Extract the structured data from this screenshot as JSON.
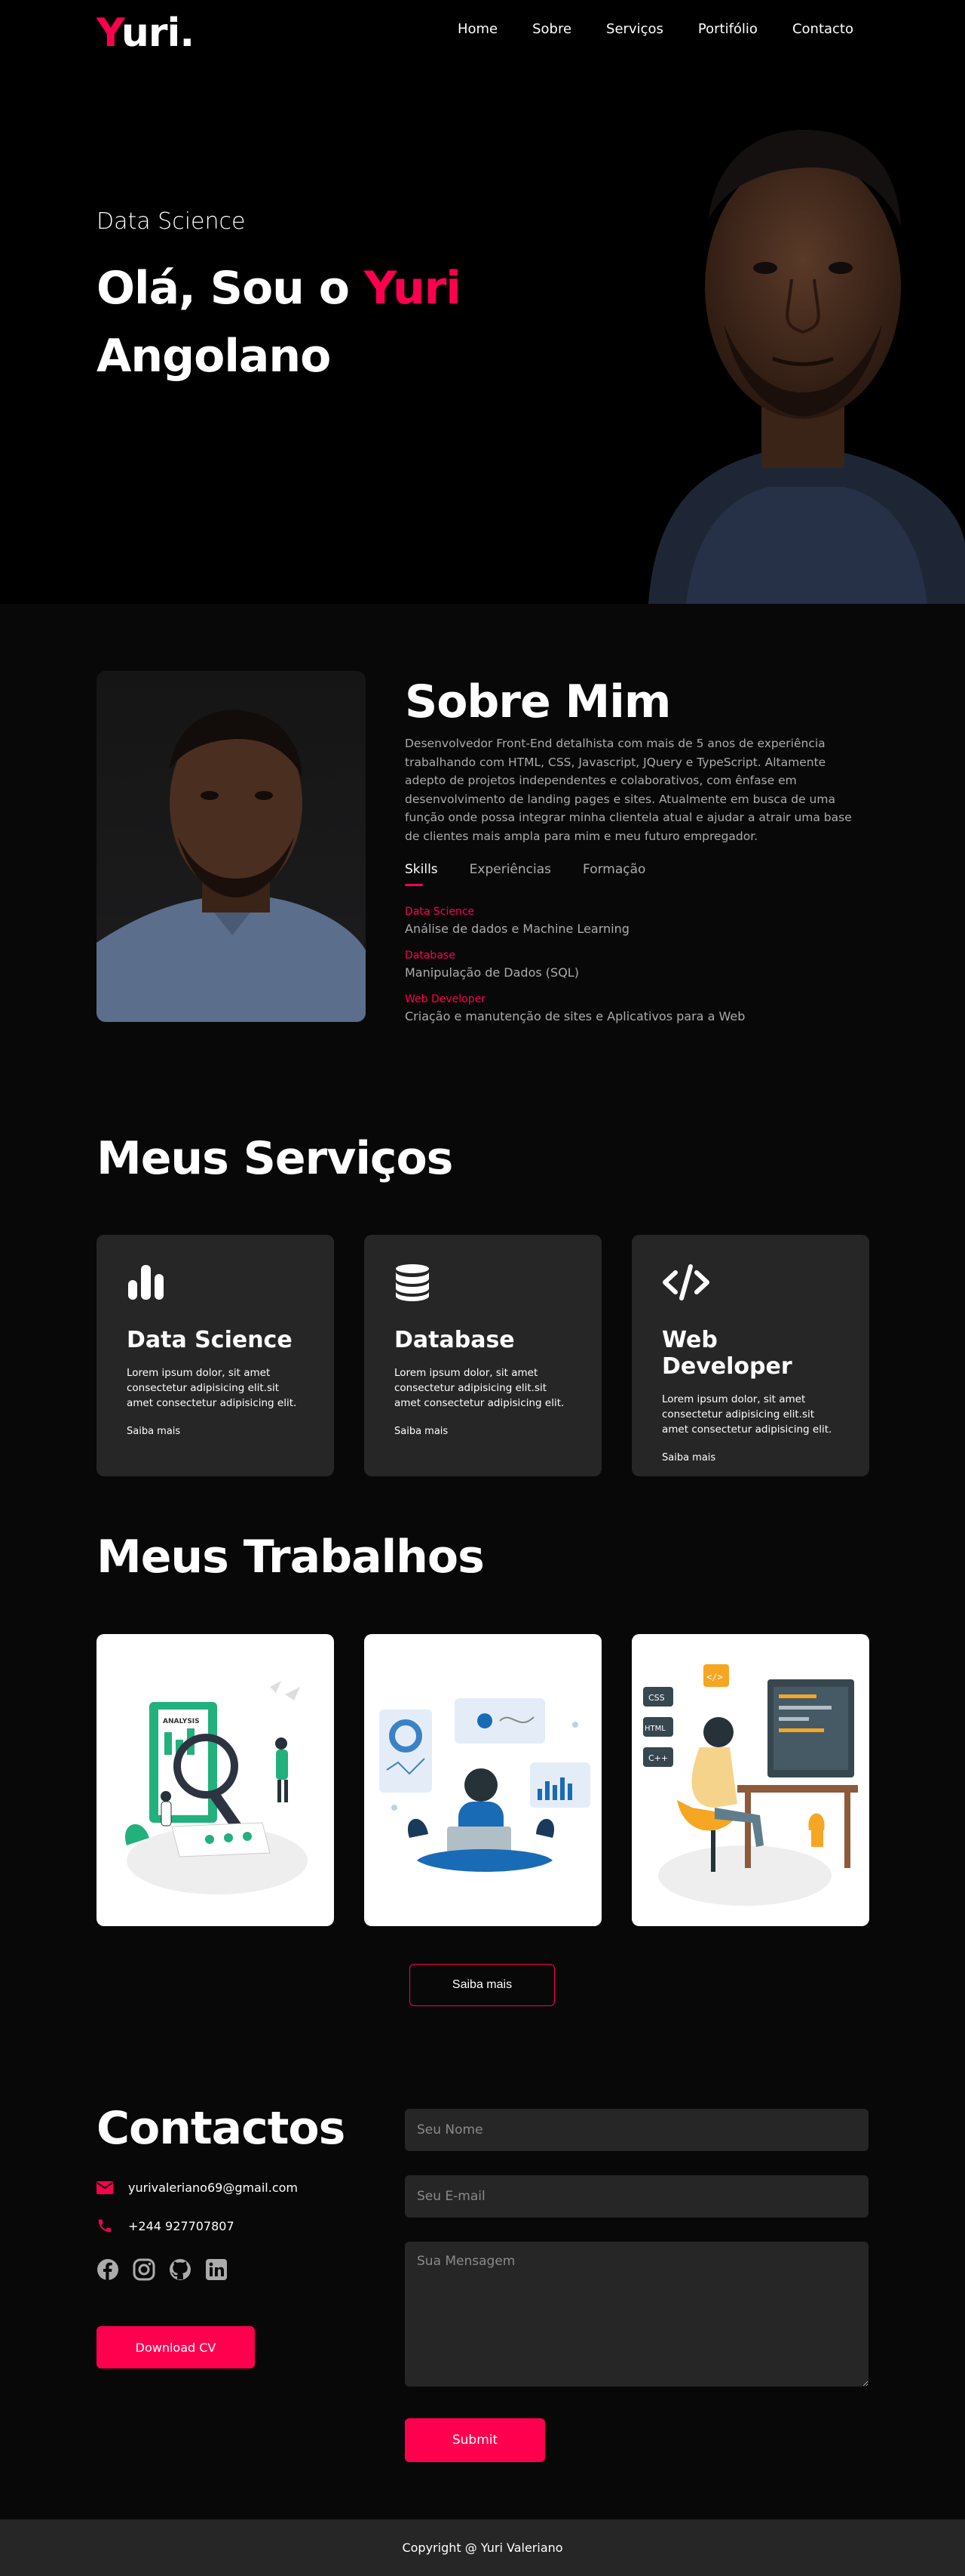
{
  "brand": {
    "logo_first": "Y",
    "logo_rest": "uri",
    "logo_dot": ".",
    "accent_color": "#ff004f"
  },
  "nav": {
    "items": [
      "Home",
      "Sobre",
      "Serviços",
      "Portifólio",
      "Contacto"
    ]
  },
  "hero": {
    "subtitle": "Data Science",
    "greeting": "Olá, Sou o ",
    "name": "Yuri",
    "line2": "Angolano"
  },
  "about": {
    "title": "Sobre Mim",
    "description": "Desenvolvedor Front-End detalhista com mais de 5 anos de experiência trabalhando com HTML, CSS, Javascript, JQuery e TypeScript. Altamente adepto de projetos independentes e colaborativos, com ênfase em desenvolvimento de landing pages e sites. Atualmente em busca de uma função onde possa integrar minha clientela atual e ajudar a atrair uma base de clientes mais ampla para mim e meu futuro empregador.",
    "tabs": [
      "Skills",
      "Experiências",
      "Formação"
    ],
    "skills": [
      {
        "name": "Data Science",
        "desc": "Análise de dados e Machine Learning"
      },
      {
        "name": "Database",
        "desc": "Manipulação de Dados (SQL)"
      },
      {
        "name": "Web Developer",
        "desc": "Criação e manutenção de sites e Aplicativos para a Web"
      }
    ]
  },
  "services": {
    "title": "Meus Serviços",
    "cards": [
      {
        "icon": "chart-bars-icon",
        "title": "Data Science",
        "text": "Lorem ipsum dolor, sit amet consectetur adipisicing elit.sit amet consectetur adipisicing elit.",
        "link": "Saiba mais"
      },
      {
        "icon": "database-icon",
        "title": "Database",
        "text": "Lorem ipsum dolor, sit amet consectetur adipisicing elit.sit amet consectetur adipisicing elit.",
        "link": "Saiba mais"
      },
      {
        "icon": "code-icon",
        "title": "Web Developer",
        "text": "Lorem ipsum dolor, sit amet consectetur adipisicing elit.sit amet consectetur adipisicing elit.",
        "link": "Saiba mais"
      }
    ]
  },
  "works": {
    "title": "Meus Trabalhos",
    "items": [
      {
        "label": "ANALYSIS"
      },
      {
        "label": ""
      },
      {
        "labels": [
          "CSS",
          "HTML",
          "C++",
          "</>"
        ]
      }
    ],
    "more_button": "Saiba mais"
  },
  "contact": {
    "title": "Contactos",
    "email": "yurivaleriano69@gmail.com",
    "phone": "+244 927707807",
    "socials": [
      "facebook-icon",
      "instagram-icon",
      "github-icon",
      "linkedin-icon"
    ],
    "cv_button": "Download CV",
    "form": {
      "name_placeholder": "Seu Nome",
      "email_placeholder": "Seu E-mail",
      "message_placeholder": "Sua Mensagem",
      "submit": "Submit"
    }
  },
  "footer": {
    "text": "Copyright @ Yuri Valeriano"
  }
}
